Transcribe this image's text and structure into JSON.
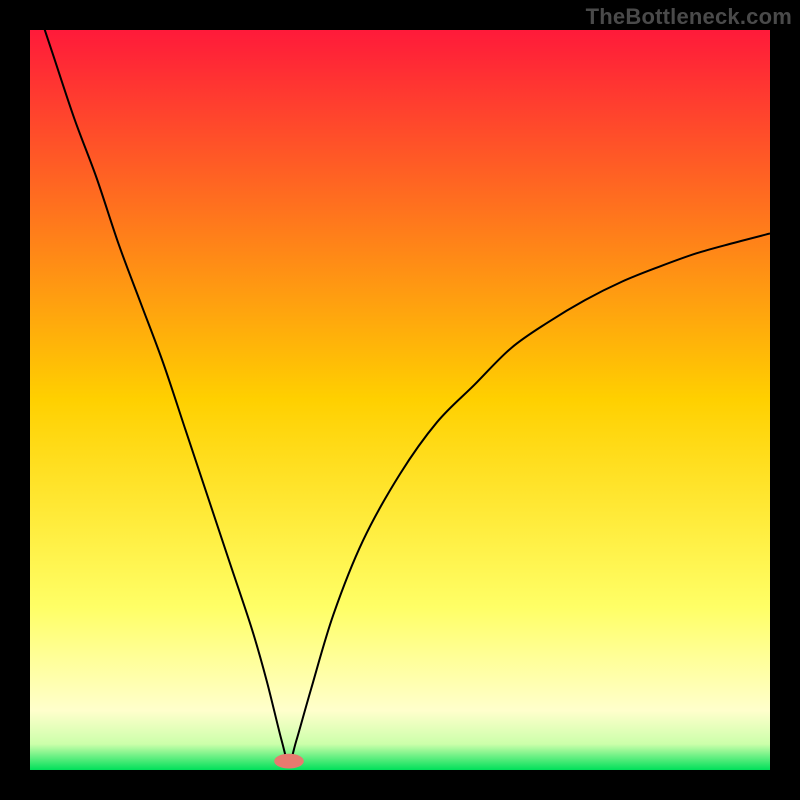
{
  "watermark": "TheBottleneck.com",
  "chart_data": {
    "type": "line",
    "title": "",
    "xlabel": "",
    "ylabel": "",
    "xlim": [
      0,
      100
    ],
    "ylim": [
      0,
      100
    ],
    "background_gradient": {
      "stops": [
        {
          "offset": 0.0,
          "color": "#ff1a3a"
        },
        {
          "offset": 0.5,
          "color": "#ffd000"
        },
        {
          "offset": 0.78,
          "color": "#ffff66"
        },
        {
          "offset": 0.92,
          "color": "#ffffcc"
        },
        {
          "offset": 0.965,
          "color": "#ccffaa"
        },
        {
          "offset": 1.0,
          "color": "#00e05a"
        }
      ]
    },
    "optimal_x": 35,
    "marker": {
      "x": 35,
      "y": 1.2,
      "color": "#e77a6f",
      "rx": 2.0,
      "ry": 1.0
    },
    "series": [
      {
        "name": "curve",
        "color": "#000000",
        "width": 2,
        "x": [
          0,
          3,
          6,
          9,
          12,
          15,
          18,
          21,
          24,
          27,
          30,
          32,
          34,
          35,
          36,
          38,
          41,
          45,
          50,
          55,
          60,
          65,
          70,
          75,
          80,
          85,
          90,
          95,
          100
        ],
        "y": [
          106,
          97,
          88,
          80,
          71,
          63,
          55,
          46,
          37,
          28,
          19,
          12,
          4,
          1,
          4,
          11,
          21,
          31,
          40,
          47,
          52,
          57,
          60.5,
          63.5,
          66,
          68,
          69.8,
          71.2,
          72.5
        ]
      }
    ]
  }
}
